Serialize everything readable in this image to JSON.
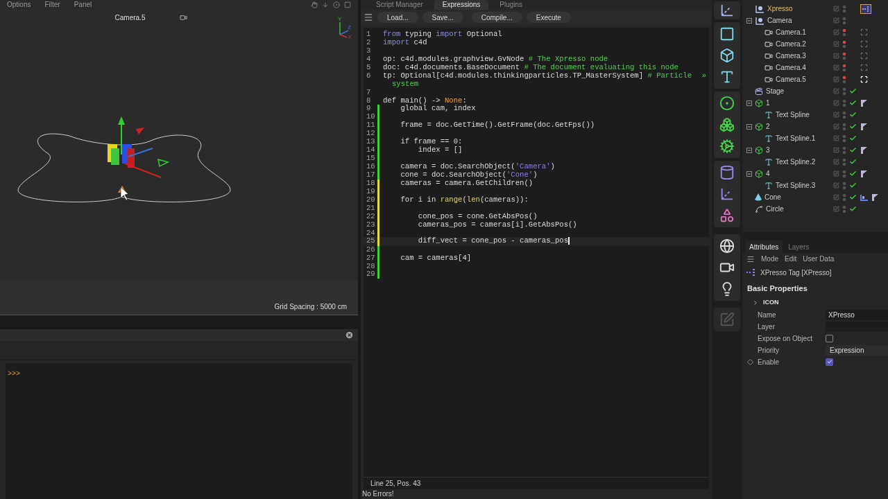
{
  "viewport": {
    "menu": [
      "Options",
      "Filter",
      "Panel"
    ],
    "camera": "Camera.5",
    "gizmo_labels": [
      "Y",
      "Z",
      "X"
    ],
    "grid_spacing": "Grid Spacing : 5000 cm"
  },
  "console": {
    "prompt": ">>>"
  },
  "editor": {
    "tabs": [
      {
        "label": "Script Manager",
        "selected": false
      },
      {
        "label": "Expressions",
        "selected": true
      },
      {
        "label": "Plugins",
        "selected": false
      }
    ],
    "toolbar": [
      "Load...",
      "Save...",
      "Compile...",
      "Execute"
    ],
    "lines": [
      {
        "number": "1",
        "current": false,
        "tokens": [
          {
            "text": "from",
            "kind": "keyword"
          },
          {
            "text": " typing ",
            "kind": "plain"
          },
          {
            "text": "import",
            "kind": "keyword"
          },
          {
            "text": " Optional",
            "kind": "plain"
          }
        ]
      },
      {
        "number": "2",
        "current": false,
        "tokens": [
          {
            "text": "import",
            "kind": "keyword"
          },
          {
            "text": " c4d",
            "kind": "plain"
          }
        ]
      },
      {
        "number": "3",
        "current": false
      },
      {
        "number": "4",
        "current": false,
        "tokens": [
          {
            "text": "op: c4d.modules.graphview.GvNode ",
            "kind": "plain"
          },
          {
            "text": "# The Xpresso node",
            "kind": "comment"
          }
        ]
      },
      {
        "number": "5",
        "current": false,
        "tokens": [
          {
            "text": "doc: c4d.documents.BaseDocument ",
            "kind": "plain"
          },
          {
            "text": "# The document evaluating this node",
            "kind": "comment"
          }
        ]
      },
      {
        "number": "6",
        "current": false,
        "tokens": [
          {
            "text": "tp: Optional[c4d.modules.thinkingparticles.TP_MasterSystem] ",
            "kind": "plain"
          },
          {
            "text": "# Particle",
            "kind": "comment"
          }
        ],
        "wrap_mark": "»",
        "continuation": [
          {
            "text": "system",
            "kind": "comment"
          }
        ]
      },
      {
        "number": "7",
        "current": false
      },
      {
        "number": "8",
        "current": false,
        "tokens": [
          {
            "text": "def main() -> ",
            "kind": "plain"
          },
          {
            "text": "None",
            "kind": "constant"
          },
          {
            "text": ":",
            "kind": "plain"
          }
        ]
      },
      {
        "number": "9",
        "current": false,
        "color": "#3ad23a",
        "tokens": [
          {
            "text": "    global cam, index",
            "kind": "plain"
          }
        ]
      },
      {
        "number": "10",
        "current": false,
        "color": "#3ad23a"
      },
      {
        "number": "11",
        "current": false,
        "color": "#3ad23a",
        "tokens": [
          {
            "text": "    frame = doc.GetTime().GetFrame(doc.GetFps())",
            "kind": "plain"
          }
        ]
      },
      {
        "number": "12",
        "current": false,
        "color": "#3ad23a"
      },
      {
        "number": "13",
        "current": false,
        "color": "#3ad23a",
        "tokens": [
          {
            "text": "    if frame == 0:",
            "kind": "plain"
          }
        ]
      },
      {
        "number": "14",
        "current": false,
        "color": "#3ad23a",
        "tokens": [
          {
            "text": "        index = []",
            "kind": "plain"
          }
        ]
      },
      {
        "number": "15",
        "current": false,
        "color": "#3ad23a"
      },
      {
        "number": "16",
        "current": false,
        "color": "#3ad23a",
        "tokens": [
          {
            "text": "    camera = doc.SearchObject(",
            "kind": "plain"
          },
          {
            "text": "'Camera'",
            "kind": "string"
          },
          {
            "text": ")",
            "kind": "plain"
          }
        ]
      },
      {
        "number": "17",
        "current": false,
        "color": "#3ad23a",
        "tokens": [
          {
            "text": "    cone = doc.SearchObject(",
            "kind": "plain"
          },
          {
            "text": "'Cone'",
            "kind": "string"
          },
          {
            "text": ")",
            "kind": "plain"
          }
        ]
      },
      {
        "number": "18",
        "current": false,
        "color": "#e3e03a",
        "tokens": [
          {
            "text": "    cameras = camera.GetChildren()",
            "kind": "plain"
          }
        ]
      },
      {
        "number": "19",
        "current": false,
        "color": "#e3e03a"
      },
      {
        "number": "20",
        "current": false,
        "color": "#e3e03a",
        "tokens": [
          {
            "text": "    for i in ",
            "kind": "plain"
          },
          {
            "text": "range",
            "kind": "builtin"
          },
          {
            "text": "(",
            "kind": "plain"
          },
          {
            "text": "len",
            "kind": "builtin"
          },
          {
            "text": "(cameras)):",
            "kind": "plain"
          }
        ]
      },
      {
        "number": "21",
        "current": false,
        "color": "#e3e03a"
      },
      {
        "number": "22",
        "current": false,
        "color": "#e3e03a",
        "tokens": [
          {
            "text": "        cone_pos = cone.GetAbsPos()",
            "kind": "plain"
          }
        ]
      },
      {
        "number": "23",
        "current": false,
        "color": "#e3e03a",
        "tokens": [
          {
            "text": "        cameras_pos = cameras[i].GetAbsPos()",
            "kind": "plain"
          }
        ]
      },
      {
        "number": "24",
        "current": false,
        "color": "#e3e03a"
      },
      {
        "number": "25",
        "current": true,
        "color": "#e3e03a",
        "tokens": [
          {
            "text": "        diff_vect = cone_pos - cameras_pos",
            "kind": "plain"
          }
        ]
      },
      {
        "number": "26",
        "current": false,
        "color": "#3ad23a"
      },
      {
        "number": "27",
        "current": false,
        "color": "#3ad23a",
        "tokens": [
          {
            "text": "    cam = cameras[4]",
            "kind": "plain"
          }
        ]
      },
      {
        "number": "28",
        "current": false,
        "color": "#3ad23a"
      },
      {
        "number": "29",
        "current": false,
        "color": "#3ad23a"
      }
    ],
    "status": "Line 25, Pos. 43",
    "message": "No Errors!"
  },
  "objects": [
    {
      "name": "Xpresso",
      "kind": "null",
      "highlighted": true,
      "hidden_in_editor": false,
      "check": false,
      "tags": [
        {
          "kind": "xpresso",
          "selected": true
        }
      ]
    },
    {
      "name": "Camera",
      "kind": "null",
      "highlighted": false,
      "hidden_in_editor": false,
      "check": false,
      "expanded": true,
      "children": [
        {
          "name": "Camera.1",
          "kind": "camera",
          "highlighted": false,
          "hidden_in_editor": true,
          "check": false,
          "tags": [
            {
              "kind": "target",
              "selected": false
            }
          ]
        },
        {
          "name": "Camera.2",
          "kind": "camera",
          "highlighted": false,
          "hidden_in_editor": true,
          "check": false,
          "tags": [
            {
              "kind": "target",
              "selected": false
            }
          ]
        },
        {
          "name": "Camera.3",
          "kind": "camera",
          "highlighted": false,
          "hidden_in_editor": true,
          "check": false,
          "tags": [
            {
              "kind": "target",
              "selected": false
            }
          ]
        },
        {
          "name": "Camera.4",
          "kind": "camera",
          "highlighted": false,
          "hidden_in_editor": true,
          "check": false,
          "tags": [
            {
              "kind": "target",
              "selected": false
            }
          ]
        },
        {
          "name": "Camera.5",
          "kind": "camera",
          "highlighted": false,
          "hidden_in_editor": true,
          "check": false,
          "tags": [
            {
              "kind": "target",
              "selected": true
            }
          ]
        }
      ]
    },
    {
      "name": "Stage",
      "kind": "stage",
      "highlighted": false,
      "hidden_in_editor": false,
      "check": true
    },
    {
      "name": "1",
      "kind": "group",
      "highlighted": false,
      "hidden_in_editor": false,
      "check": true,
      "expanded": true,
      "tags": [
        {
          "kind": "material",
          "selected": false
        }
      ],
      "children": [
        {
          "name": "Text Spline",
          "kind": "text",
          "highlighted": false,
          "hidden_in_editor": false,
          "check": true
        }
      ]
    },
    {
      "name": "2",
      "kind": "group",
      "highlighted": false,
      "hidden_in_editor": false,
      "check": true,
      "expanded": true,
      "tags": [
        {
          "kind": "material",
          "selected": false
        }
      ],
      "children": [
        {
          "name": "Text Spline.1",
          "kind": "text",
          "highlighted": false,
          "hidden_in_editor": false,
          "check": true
        }
      ]
    },
    {
      "name": "3",
      "kind": "group",
      "highlighted": false,
      "hidden_in_editor": false,
      "check": true,
      "expanded": true,
      "tags": [
        {
          "kind": "material",
          "selected": false
        }
      ],
      "children": [
        {
          "name": "Text Spline.2",
          "kind": "text",
          "highlighted": false,
          "hidden_in_editor": false,
          "check": true
        }
      ]
    },
    {
      "name": "4",
      "kind": "group",
      "highlighted": false,
      "hidden_in_editor": false,
      "check": true,
      "expanded": true,
      "tags": [
        {
          "kind": "material",
          "selected": false
        }
      ],
      "children": [
        {
          "name": "Text Spline.3",
          "kind": "text",
          "highlighted": false,
          "hidden_in_editor": false,
          "check": true
        }
      ]
    },
    {
      "name": "Cone",
      "kind": "cone",
      "highlighted": false,
      "hidden_in_editor": false,
      "check": true,
      "tags": [
        {
          "kind": "uvw",
          "selected": false
        },
        {
          "kind": "material",
          "selected": false
        }
      ]
    },
    {
      "name": "Circle",
      "kind": "spline",
      "highlighted": false,
      "hidden_in_editor": false,
      "check": true
    }
  ],
  "attributes": {
    "tabs": [
      {
        "label": "Attributes",
        "selected": true
      },
      {
        "label": "Layers",
        "selected": false
      }
    ],
    "menu": [
      "Mode",
      "Edit",
      "User Data"
    ],
    "title": "XPresso Tag [XPresso]",
    "section": "Basic Properties",
    "group": {
      "label": "ICON",
      "expanded": false
    },
    "properties": [
      {
        "label": "Name",
        "kind": "field",
        "value": "XPresso",
        "keyframe": false
      },
      {
        "label": "Layer",
        "kind": "field",
        "keyframe": false
      },
      {
        "label": "Expose on Object",
        "kind": "checkbox",
        "checked": false,
        "keyframe": false
      },
      {
        "label": "Priority",
        "kind": "dropdown",
        "value": "Expression",
        "keyframe": false
      },
      {
        "label": "Enable",
        "kind": "checkbox",
        "checked": true,
        "keyframe": true
      }
    ]
  }
}
